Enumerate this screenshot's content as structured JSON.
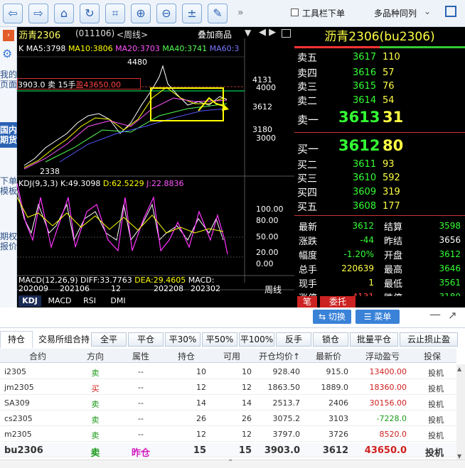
{
  "toolbar": {
    "more": "»",
    "checkbox_label": "工具栏下单",
    "dropdown": "多品种同列"
  },
  "sidebar": {
    "items": [
      "我的页面",
      "国内期货",
      "下单模板",
      "期权报价"
    ]
  },
  "chart": {
    "title": "沥青2306",
    "code": "(011106)",
    "period": "<周线>",
    "overlay": "叠加商品",
    "nav": "◀ ▶",
    "ma": {
      "k": "K",
      "ma5": "MA5:3798",
      "ma10": "MA10:3806",
      "ma20": "MA20:3703",
      "ma40": "MA40:3741",
      "ma60": "MA60:3"
    },
    "position_label": "3903.0  卖  15手",
    "position_pnl": "盈43650.00",
    "price_high": "4480",
    "price_low": "2338",
    "axis": {
      "p4131": "4131",
      "p4000": "4000",
      "p3612": "3612",
      "p3180": "3180",
      "p3000": "3000"
    },
    "kdj_label": "KDJ(9,3,3)",
    "kdj_k": "K:49.3098",
    "kdj_d": "D:62.5229",
    "kdj_j": "J:22.8836",
    "kdj_axis": [
      "100.00",
      "80.00",
      "50.00",
      "20.00",
      "0.00"
    ],
    "macd_label": "MACD(12,26,9)",
    "macd_diff": "DIFF:33.7763",
    "macd_dea": "DEA:29.4605",
    "macd_macd": "MACD:",
    "dates": [
      "202009",
      "202106",
      "12",
      "202208",
      "202302"
    ],
    "period_label": "周线",
    "tabs": [
      "KDJ",
      "MACD",
      "RSI",
      "DMI"
    ]
  },
  "quote": {
    "title": "沥青2306(bu2306)",
    "asks": [
      {
        "label": "卖五",
        "price": "3617",
        "vol": "110"
      },
      {
        "label": "卖四",
        "price": "3616",
        "vol": "57"
      },
      {
        "label": "卖三",
        "price": "3615",
        "vol": "76"
      },
      {
        "label": "卖二",
        "price": "3614",
        "vol": "54"
      }
    ],
    "ask1": {
      "label": "卖一",
      "price": "3613",
      "vol": "31"
    },
    "bid1": {
      "label": "买一",
      "price": "3612",
      "vol": "80"
    },
    "bids": [
      {
        "label": "买二",
        "price": "3611",
        "vol": "93"
      },
      {
        "label": "买三",
        "price": "3610",
        "vol": "592"
      },
      {
        "label": "买四",
        "price": "3609",
        "vol": "319"
      },
      {
        "label": "买五",
        "price": "3608",
        "vol": "177"
      }
    ],
    "stats": [
      {
        "l1": "最新",
        "v1": "3612",
        "l2": "结算",
        "v2": "3598"
      },
      {
        "l1": "涨跌",
        "v1": "-44",
        "l2": "昨结",
        "v2": "3656"
      },
      {
        "l1": "幅度",
        "v1": "-1.20%",
        "l2": "开盘",
        "v2": "3612"
      },
      {
        "l1": "总手",
        "v1": "220639",
        "l2": "最高",
        "v2": "3646"
      },
      {
        "l1": "现手",
        "v1": "1",
        "l2": "最低",
        "v2": "3561"
      },
      {
        "l1": "涨停",
        "v1": "4131",
        "l2": "跌停",
        "v2": "3180"
      }
    ],
    "tabs": [
      "笔",
      "委托"
    ],
    "switch": "⇆ 切换",
    "menu": "☰ 菜单"
  },
  "positions": {
    "tabs": [
      "持仓",
      "交易所组合持"
    ],
    "actions": [
      "全平",
      "平仓",
      "平30%",
      "平50%",
      "平100%",
      "反手",
      "锁仓",
      "批量平仓",
      "云止损止盈"
    ],
    "headers": [
      "合约",
      "方向",
      "属性",
      "持仓",
      "可用",
      "开仓均价↑",
      "最新价",
      "浮动盈亏",
      "投保"
    ],
    "rows": [
      [
        "i2305",
        "卖",
        "--",
        "10",
        "10",
        "928.40",
        "915.0",
        "13400.00",
        "投机"
      ],
      [
        "jm2305",
        "买",
        "--",
        "12",
        "12",
        "1863.50",
        "1889.0",
        "18360.00",
        "投机"
      ],
      [
        "SA309",
        "卖",
        "--",
        "14",
        "14",
        "2513.7",
        "2406",
        "30156.00",
        "投机"
      ],
      [
        "cs2305",
        "卖",
        "--",
        "26",
        "26",
        "3075.2",
        "3103",
        "-7228.0",
        "投机"
      ],
      [
        "m2305",
        "卖",
        "--",
        "12",
        "12",
        "3797.0",
        "3726",
        "8520.0",
        "投机"
      ],
      [
        "bu2306",
        "卖",
        "昨仓",
        "15",
        "15",
        "3903.0",
        "3612",
        "43650.0",
        "投机"
      ]
    ]
  }
}
